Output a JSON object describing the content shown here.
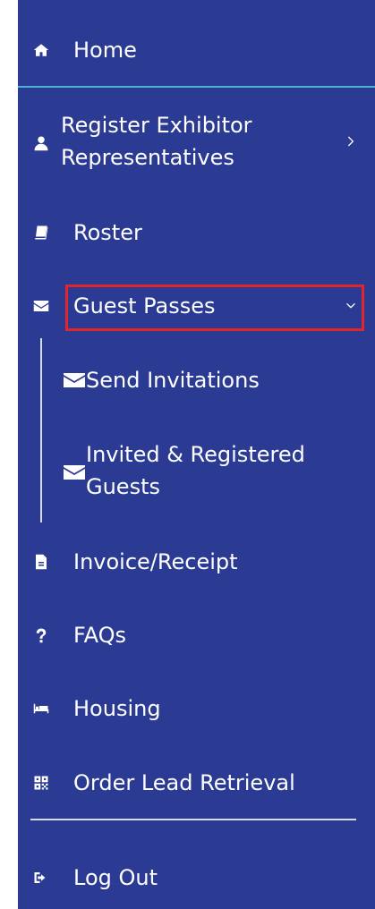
{
  "nav": {
    "home": {
      "label": "Home",
      "icon": "home-icon"
    },
    "register": {
      "label": "Register Exhibitor Representatives",
      "icon": "user-icon"
    },
    "roster": {
      "label": "Roster",
      "icon": "book-icon"
    },
    "guest_passes": {
      "label": "Guest Passes",
      "icon": "envelope-icon",
      "expanded": true,
      "submenu": [
        {
          "label": "Send Invitations",
          "icon": "envelope-icon"
        },
        {
          "label": "Invited & Registered Guests",
          "icon": "envelope-icon"
        }
      ]
    },
    "invoice": {
      "label": "Invoice/Receipt",
      "icon": "document-icon"
    },
    "faqs": {
      "label": "FAQs",
      "icon": "question-icon"
    },
    "housing": {
      "label": "Housing",
      "icon": "bed-icon"
    },
    "order_lead": {
      "label": "Order Lead Retrieval",
      "icon": "qr-code-icon"
    },
    "logout": {
      "label": "Log Out",
      "icon": "sign-out-icon"
    }
  },
  "colors": {
    "sidebar_bg": "#2b3a93",
    "accent_line": "#4fb0d3",
    "highlight": "#e0262b",
    "text": "#ffffff"
  }
}
